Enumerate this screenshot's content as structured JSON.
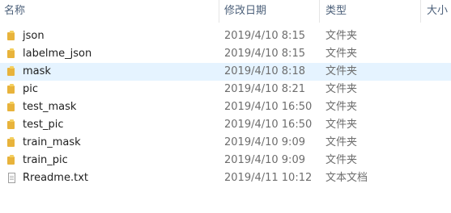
{
  "columns": {
    "name": "名称",
    "date": "修改日期",
    "type": "类型",
    "size": "大小"
  },
  "selected_index": 2,
  "files": [
    {
      "name": "json",
      "date": "2019/4/10 8:15",
      "type": "文件夹",
      "icon": "folder-icon"
    },
    {
      "name": "labelme_json",
      "date": "2019/4/10 8:15",
      "type": "文件夹",
      "icon": "folder-icon"
    },
    {
      "name": "mask",
      "date": "2019/4/10 8:18",
      "type": "文件夹",
      "icon": "folder-icon"
    },
    {
      "name": "pic",
      "date": "2019/4/10 8:21",
      "type": "文件夹",
      "icon": "folder-icon"
    },
    {
      "name": "test_mask",
      "date": "2019/4/10 16:50",
      "type": "文件夹",
      "icon": "folder-icon"
    },
    {
      "name": "test_pic",
      "date": "2019/4/10 16:50",
      "type": "文件夹",
      "icon": "folder-icon"
    },
    {
      "name": "train_mask",
      "date": "2019/4/10 9:09",
      "type": "文件夹",
      "icon": "folder-icon"
    },
    {
      "name": "train_pic",
      "date": "2019/4/10 9:09",
      "type": "文件夹",
      "icon": "folder-icon"
    },
    {
      "name": "Rreadme.txt",
      "date": "2019/4/11 10:12",
      "type": "文本文档",
      "icon": "text-file-icon"
    }
  ]
}
